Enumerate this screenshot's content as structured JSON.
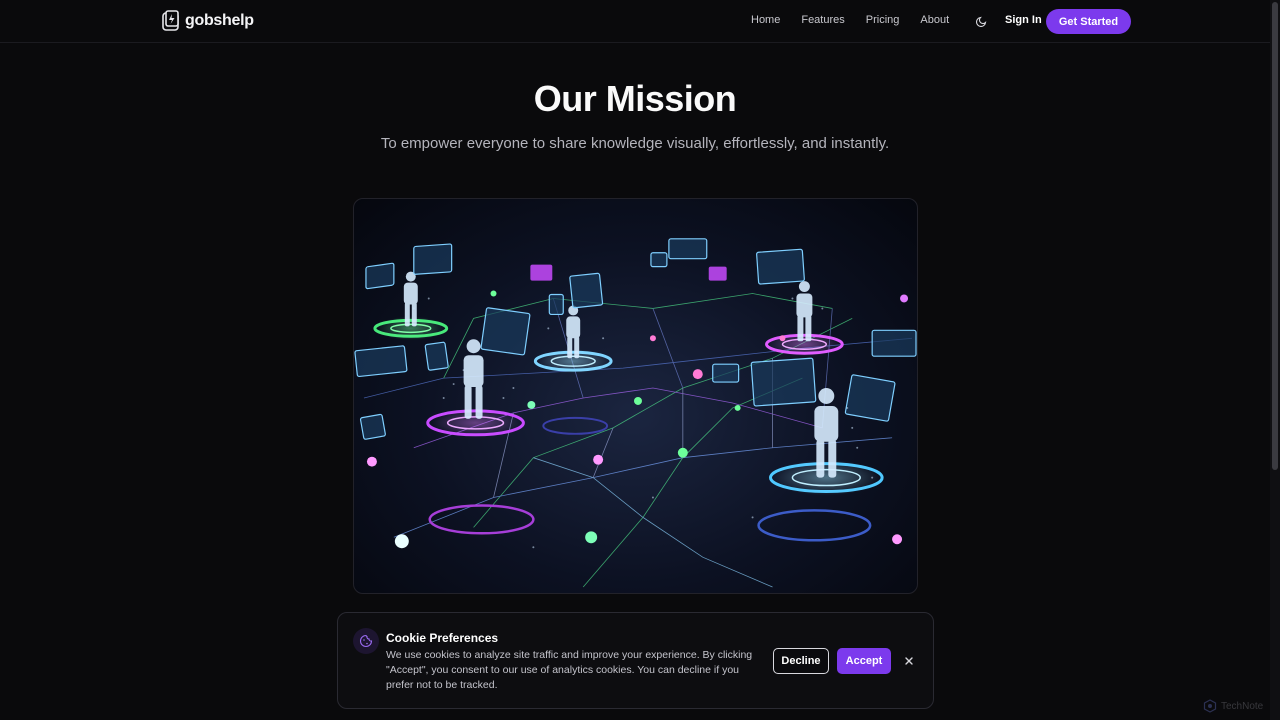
{
  "header": {
    "logo_text": "gobshelp",
    "nav": [
      "Home",
      "Features",
      "Pricing",
      "About"
    ],
    "theme_icon": "moon-icon",
    "sign_in": "Sign In",
    "cta": "Get Started"
  },
  "hero": {
    "title": "Our Mission",
    "subtitle": "To empower everyone to share knowledge visually, effortlessly, and instantly.",
    "image_alt": "Network of holographic people connected by glowing lines"
  },
  "cookie": {
    "title": "Cookie Preferences",
    "text": "We use cookies to analyze site traffic and improve your experience. By clicking \"Accept\", you consent to our use of analytics cookies. You can decline if you prefer not to be tracked.",
    "decline": "Decline",
    "accept": "Accept",
    "icon": "cookie-icon",
    "close_icon": "close-icon"
  },
  "watermark": "TechNote",
  "colors": {
    "accent": "#7c3aed",
    "background": "#0a0a0c"
  }
}
